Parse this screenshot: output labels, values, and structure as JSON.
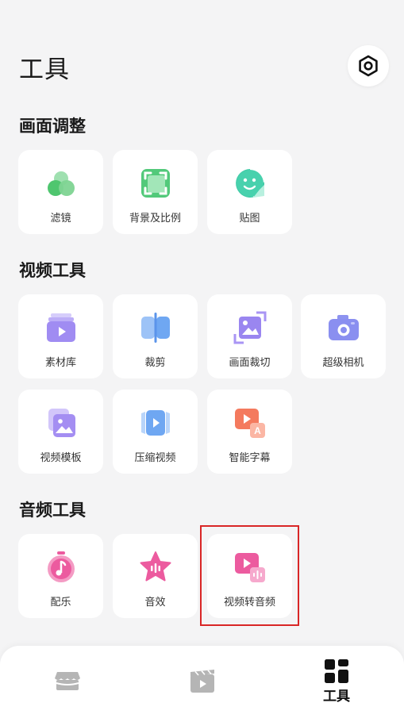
{
  "header": {
    "title": "工具",
    "settings_icon": "settings-hex-icon"
  },
  "sections": {
    "adjust": {
      "title": "画面调整",
      "items": [
        {
          "label": "滤镜",
          "icon": "filter-icon"
        },
        {
          "label": "背景及比例",
          "icon": "background-ratio-icon"
        },
        {
          "label": "贴图",
          "icon": "sticker-icon"
        }
      ]
    },
    "video": {
      "title": "视频工具",
      "items": [
        {
          "label": "素材库",
          "icon": "material-library-icon"
        },
        {
          "label": "裁剪",
          "icon": "trim-icon"
        },
        {
          "label": "画面裁切",
          "icon": "crop-icon"
        },
        {
          "label": "超级相机",
          "icon": "camera-icon"
        },
        {
          "label": "视频模板",
          "icon": "video-template-icon"
        },
        {
          "label": "压缩视频",
          "icon": "compress-video-icon"
        },
        {
          "label": "智能字幕",
          "icon": "smart-subtitle-icon"
        }
      ]
    },
    "audio": {
      "title": "音频工具",
      "items": [
        {
          "label": "配乐",
          "icon": "music-icon"
        },
        {
          "label": "音效",
          "icon": "sound-effect-icon"
        },
        {
          "label": "视频转音频",
          "icon": "video-to-audio-icon"
        }
      ]
    }
  },
  "bottom_nav": {
    "items": [
      {
        "icon": "store-icon",
        "label": ""
      },
      {
        "icon": "clapperboard-icon",
        "label": ""
      },
      {
        "icon": "tools-grid-icon",
        "label": "工具",
        "active": true
      }
    ]
  },
  "colors": {
    "background": "#f4f4f5",
    "card": "#ffffff",
    "highlight_border": "#d92626",
    "green_accent": "#4fc66f",
    "pink_accent": "#ec5b9f",
    "purple_accent": "#9e84f0"
  }
}
